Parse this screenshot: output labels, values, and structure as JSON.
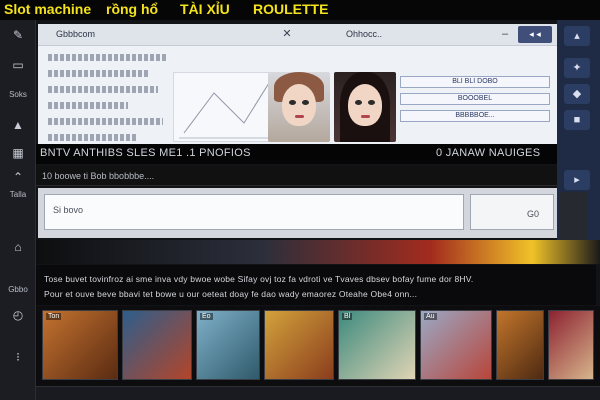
{
  "top_links": [
    "Slot machine",
    "rồng hổ",
    "TÀI XỈU",
    "ROULETTE"
  ],
  "colors": {
    "top_link": "#f3e21c",
    "accent": "#3f4f7a",
    "banner": "#050505"
  },
  "sidebar": {
    "icons": [
      "pen-icon",
      "menu-icon",
      "triangle-icon",
      "grid-icon",
      "up-arrow-icon",
      "home-icon",
      "dial-icon",
      "grid-dots-icon"
    ],
    "labels": [
      "Soks",
      "Talla",
      "Gbbo"
    ]
  },
  "window": {
    "title": "Gbbbcom",
    "title2": "Ohhocc.."
  },
  "right_panel": [
    "BLI BLI DOBO",
    "BOOOBEL",
    "BBBBBOE..."
  ],
  "banner": {
    "left": "BNTV ANTHIBS SLES ME1 .1 PNOFIOS",
    "right": "0 JANAW NAUIGES"
  },
  "subbanner": "10 boowe ti Bob bbobbbe....",
  "form": {
    "field_value": "Si bovo",
    "side_value": "G0"
  },
  "news": [
    "Tose buvet tovinfroz ai sme inva vdy bwoe wobe Sifay ovj toz fa vdroti ve Tvaves dbsev bofay fume dor 8HV.",
    "Pour et ouve beve bbavi tet bowe u our oeteat doay fe dao wady emaorez Oteahe Obe4 onn..."
  ],
  "thumbs": [
    "Ton",
    "Eo",
    "Bl",
    "Au"
  ]
}
